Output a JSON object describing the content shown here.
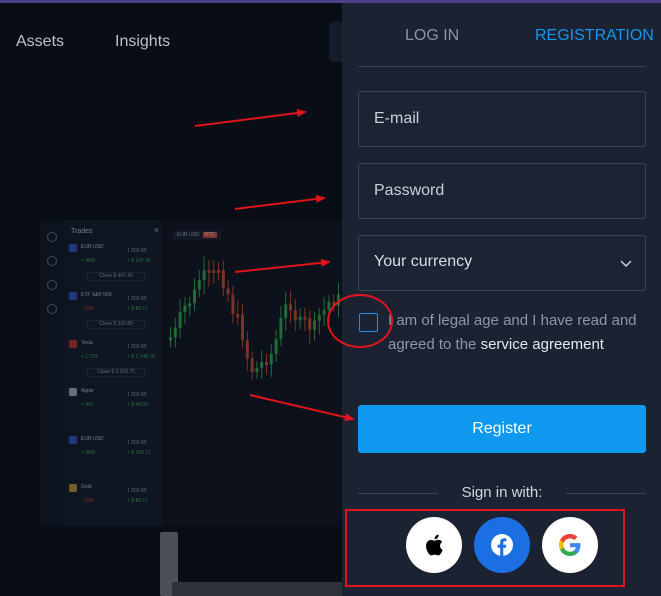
{
  "background": {
    "nav_items": [
      "Assets",
      "Insights"
    ],
    "preview": {
      "panel_title": "Trades",
      "close_glyph": "×",
      "chart_tag": "EUR USD",
      "chart_tag_badge": "OTC",
      "trades": [
        {
          "name": "EUR USD",
          "change": "+ 48%",
          "price": "1 000.00",
          "profit": "+ $ 147.40",
          "close": "Close  $ 447.43",
          "color": "#3b5bd6"
        },
        {
          "name": "ETF S&P 500",
          "change": "- 12%",
          "price": "1 000.00",
          "profit": "+ $ 80.11",
          "close": "Close  $ 336.89",
          "color": "#3b5bd6"
        },
        {
          "name": "Tesla",
          "change": "+ 172%",
          "price": "1 000.00",
          "profit": "+ $ 1,248.78",
          "close": "Close  $ 2,918.70",
          "color": "#d23c36"
        },
        {
          "name": "Apple",
          "change": "+ 4%",
          "price": "1 000.00",
          "profit": "+ $ 44.00",
          "close": "",
          "color": "#b8bec8"
        },
        {
          "name": "EUR USD",
          "change": "+ 98%",
          "price": "1 000.00",
          "profit": "+ $ 188.11",
          "close": "",
          "color": "#3b5bd6"
        },
        {
          "name": "Gold",
          "change": "- 12%",
          "price": "1 000.00",
          "profit": "+ $ 80.11",
          "close": "",
          "color": "#c9a23a"
        }
      ]
    }
  },
  "auth": {
    "tabs": {
      "login": "LOG IN",
      "registration": "REGISTRATION",
      "active": "registration"
    },
    "email_placeholder": "E-mail",
    "password_placeholder": "Password",
    "currency_label": "Your currency",
    "agreement_text": "I am of legal age and I have read and agreed to the",
    "agreement_link": "service agreement",
    "register_label": "Register",
    "sign_in_with": "Sign in with:",
    "social": [
      {
        "name": "apple",
        "icon": "apple-icon"
      },
      {
        "name": "facebook",
        "icon": "facebook-icon"
      },
      {
        "name": "google",
        "icon": "google-icon"
      }
    ]
  },
  "colors": {
    "accent": "#0e98f0",
    "active_tab": "#1596ef",
    "panel": "#1b2333",
    "annotation": "#e0141c",
    "facebook": "#1b6fe2"
  }
}
